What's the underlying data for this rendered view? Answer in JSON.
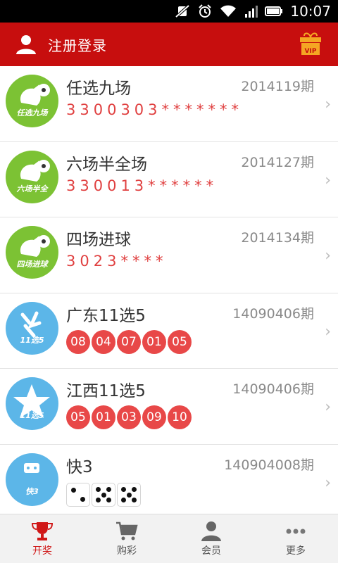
{
  "status_bar": {
    "time": "10:07"
  },
  "header": {
    "login_label": "注册登录",
    "vip_label": "VIP"
  },
  "lotteries": [
    {
      "name": "任选九场",
      "issue": "2014119期",
      "numbers": "3300303*******",
      "logo_text": "任选九场"
    },
    {
      "name": "六场半全场",
      "issue": "2014127期",
      "numbers": "330013******",
      "logo_text": "六场半全"
    },
    {
      "name": "四场进球",
      "issue": "2014134期",
      "numbers": "3023****",
      "logo_text": "四场进球"
    },
    {
      "name": "广东11选5",
      "issue": "14090406期",
      "balls": [
        "08",
        "04",
        "07",
        "01",
        "05"
      ],
      "logo_text": "11选5"
    },
    {
      "name": "江西11选5",
      "issue": "14090406期",
      "balls": [
        "05",
        "01",
        "03",
        "09",
        "10"
      ],
      "logo_text": "11选5"
    },
    {
      "name": "快3",
      "issue": "140904008期",
      "dice": [
        2,
        5,
        5
      ],
      "logo_text": "快3"
    }
  ],
  "tabs": [
    {
      "label": "开奖",
      "icon": "trophy-icon",
      "active": true
    },
    {
      "label": "购彩",
      "icon": "cart-icon",
      "active": false
    },
    {
      "label": "会员",
      "icon": "member-icon",
      "active": false
    },
    {
      "label": "更多",
      "icon": "more-icon",
      "active": false
    }
  ],
  "colors": {
    "header": "#c70e0e",
    "accent": "#e84848",
    "football_logo": "#7cc234",
    "lottery_logo": "#5cb6e8"
  }
}
